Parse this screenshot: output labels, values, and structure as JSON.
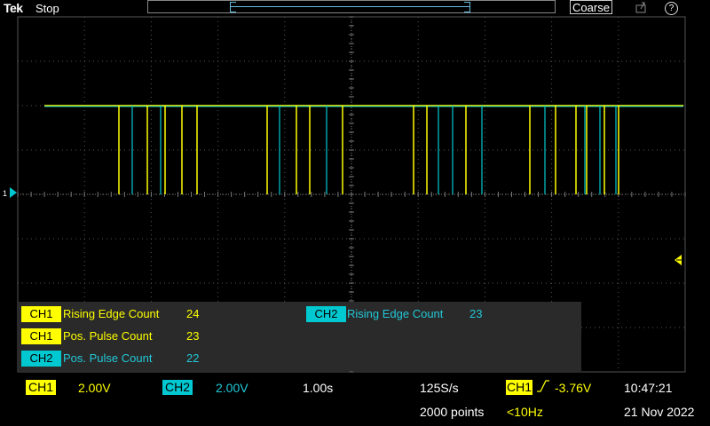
{
  "top": {
    "logo": "Tek",
    "run_state": "Stop",
    "adjust_mode": "Coarse",
    "export_icon": "export-icon",
    "help_label": "?"
  },
  "colors": {
    "ch1": "#ffff00",
    "ch2": "#00c8d0",
    "grid": "#555555"
  },
  "markers": {
    "ch_ref": "1"
  },
  "measurements": [
    {
      "channel": "CH1",
      "label": "Rising Edge Count",
      "value": "24"
    },
    {
      "channel": "CH1",
      "label": "Pos. Pulse Count",
      "value": "23"
    },
    {
      "channel": "CH2",
      "label": "Pos. Pulse Count",
      "value": "22"
    },
    {
      "channel": "CH2",
      "label": "Rising Edge Count",
      "value": "23"
    }
  ],
  "status": {
    "ch1_label": "CH1",
    "ch1_scale": "2.00V",
    "ch2_label": "CH2",
    "ch2_scale": "2.00V",
    "timebase": "1.00s",
    "sample_rate": "125S/s",
    "record_length": "2000 points",
    "trigger_channel": "CH1",
    "trigger_level": "-3.76V",
    "trigger_freq": "<10Hz",
    "time": "10:47:21",
    "date": "21 Nov 2022"
  }
}
